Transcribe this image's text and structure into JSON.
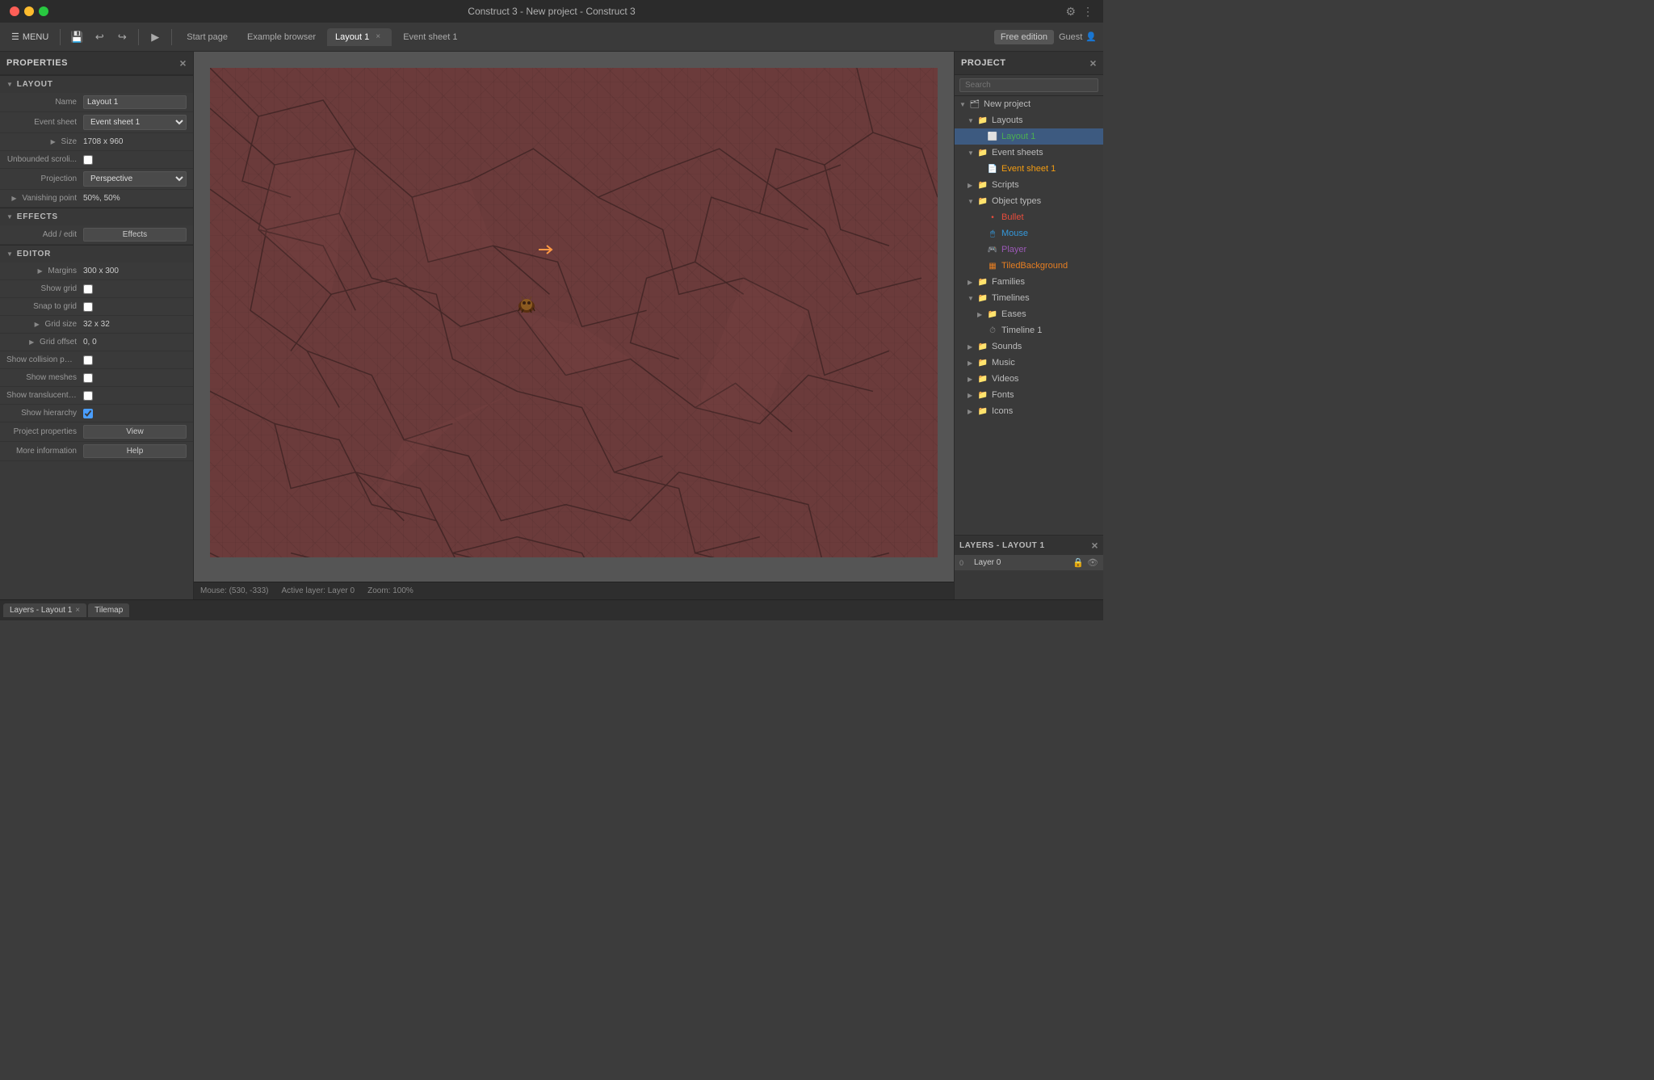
{
  "app": {
    "title": "Construct 3 - New project - Construct 3"
  },
  "titlebar": {
    "close_icon": "×",
    "settings_icon": "⚙",
    "more_icon": "⋮"
  },
  "toolbar": {
    "menu_label": "MENU",
    "save_icon": "💾",
    "undo_icon": "↩",
    "redo_icon": "↪",
    "play_icon": "▶",
    "tabs": [
      {
        "label": "Start page",
        "active": false,
        "closeable": false
      },
      {
        "label": "Example browser",
        "active": false,
        "closeable": false
      },
      {
        "label": "Layout 1",
        "active": true,
        "closeable": true
      },
      {
        "label": "Event sheet 1",
        "active": false,
        "closeable": false
      }
    ],
    "free_edition": "Free edition",
    "guest": "Guest"
  },
  "properties": {
    "title": "PROPERTIES",
    "sections": {
      "layout": {
        "label": "LAYOUT",
        "name_label": "Name",
        "name_value": "Layout 1",
        "event_sheet_label": "Event sheet",
        "event_sheet_value": "Event sheet 1",
        "size_label": "Size",
        "size_value": "1708 x 960",
        "unbounded_scroll_label": "Unbounded scroli...",
        "projection_label": "Projection",
        "projection_value": "Perspective",
        "vanishing_point_label": "Vanishing point",
        "vanishing_point_value": "50%, 50%"
      },
      "effects": {
        "label": "EFFECTS",
        "add_edit_label": "Add / edit",
        "effects_btn": "Effects"
      },
      "editor": {
        "label": "EDITOR",
        "margins_label": "Margins",
        "margins_value": "300 x 300",
        "show_grid_label": "Show grid",
        "snap_to_grid_label": "Snap to grid",
        "grid_size_label": "Grid size",
        "grid_size_value": "32 x 32",
        "grid_offset_label": "Grid offset",
        "grid_offset_value": "0, 0",
        "show_collision_label": "Show collision pol...",
        "show_meshes_label": "Show meshes",
        "show_translucent_label": "Show translucent i...",
        "show_hierarchy_label": "Show hierarchy",
        "project_props_label": "Project properties",
        "project_props_btn": "View",
        "more_info_label": "More information",
        "more_info_btn": "Help"
      }
    }
  },
  "project": {
    "title": "PROJECT",
    "search_placeholder": "Search",
    "tree": [
      {
        "label": "New project",
        "level": 0,
        "type": "root",
        "expanded": true
      },
      {
        "label": "Layouts",
        "level": 1,
        "type": "folder",
        "expanded": true
      },
      {
        "label": "Layout 1",
        "level": 2,
        "type": "layout",
        "selected": true
      },
      {
        "label": "Event sheets",
        "level": 1,
        "type": "folder",
        "expanded": true
      },
      {
        "label": "Event sheet 1",
        "level": 2,
        "type": "event",
        "selected": false
      },
      {
        "label": "Scripts",
        "level": 1,
        "type": "folder",
        "expanded": false
      },
      {
        "label": "Object types",
        "level": 1,
        "type": "folder",
        "expanded": true
      },
      {
        "label": "Bullet",
        "level": 2,
        "type": "object-bullet"
      },
      {
        "label": "Mouse",
        "level": 2,
        "type": "object-mouse"
      },
      {
        "label": "Player",
        "level": 2,
        "type": "object-player"
      },
      {
        "label": "TiledBackground",
        "level": 2,
        "type": "object-tiled"
      },
      {
        "label": "Families",
        "level": 1,
        "type": "folder",
        "expanded": false
      },
      {
        "label": "Timelines",
        "level": 1,
        "type": "folder",
        "expanded": true
      },
      {
        "label": "Eases",
        "level": 2,
        "type": "folder",
        "expanded": false
      },
      {
        "label": "Timeline 1",
        "level": 2,
        "type": "timeline"
      },
      {
        "label": "Sounds",
        "level": 1,
        "type": "folder",
        "expanded": false
      },
      {
        "label": "Music",
        "level": 1,
        "type": "folder",
        "expanded": false
      },
      {
        "label": "Videos",
        "level": 1,
        "type": "folder",
        "expanded": false
      },
      {
        "label": "Fonts",
        "level": 1,
        "type": "folder",
        "expanded": false
      },
      {
        "label": "Icons",
        "level": 1,
        "type": "folder",
        "expanded": false
      }
    ]
  },
  "layers": {
    "title": "LAYERS - LAYOUT 1",
    "items": [
      {
        "num": "0",
        "name": "Layer 0"
      }
    ]
  },
  "statusbar": {
    "mouse": "Mouse: (530, -333)",
    "active_layer": "Active layer: Layer 0",
    "zoom": "Zoom: 100%"
  },
  "bottom_tabs": [
    {
      "label": "Layers - Layout 1",
      "closeable": true
    },
    {
      "label": "Tilemap",
      "closeable": false
    }
  ]
}
